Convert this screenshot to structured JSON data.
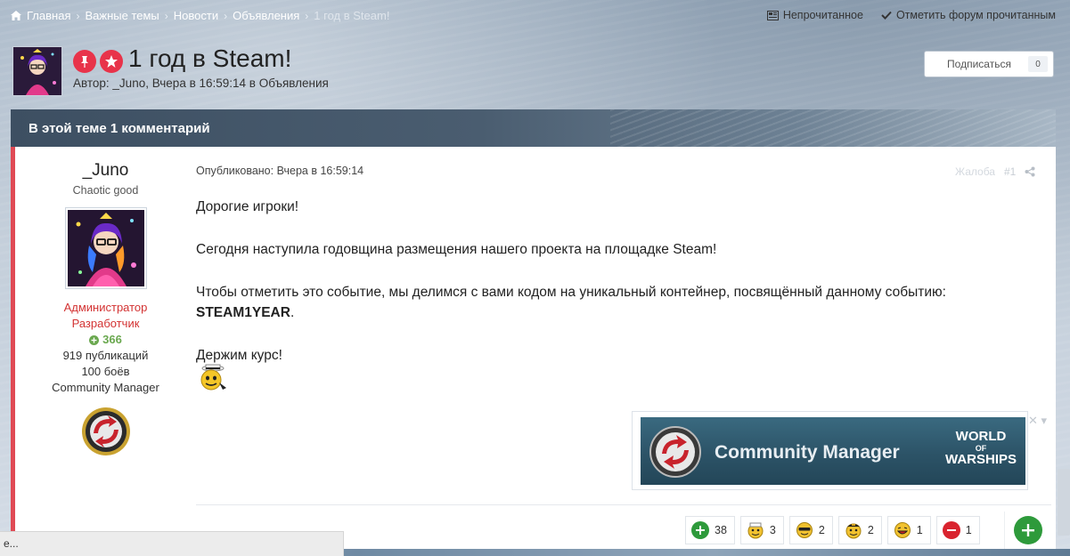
{
  "breadcrumb": {
    "items": [
      "Главная",
      "Важные темы",
      "Новости",
      "Объявления"
    ],
    "current": "1 год в Steam!"
  },
  "top_actions": {
    "unread": "Непрочитанное",
    "mark_read": "Отметить форум прочитанным"
  },
  "topic": {
    "title": "1 год в Steam!",
    "byline": "Автор: _Juno, Вчера в 16:59:14 в Объявления",
    "subscribe_label": "Подписаться",
    "subscribe_count": "0"
  },
  "comments_bar": "В этой теме 1 комментарий",
  "post": {
    "author": {
      "name": "_Juno",
      "title": "Chaotic good",
      "role1": "Администратор",
      "role2": "Разработчик",
      "reputation": "366",
      "posts": "919 публикаций",
      "battles": "100 боёв",
      "group": "Community Manager"
    },
    "meta": "Опубликовано: Вчера в 16:59:14",
    "report": "Жалоба",
    "number": "#1",
    "body": {
      "p1": "Дорогие игроки!",
      "p2": "Сегодня наступила годовщина размещения нашего проекта на площадке Steam!",
      "p3": "Чтобы отметить это событие, мы делимся с вами кодом на уникальный контейнер, посвящённый данному событию:",
      "code": "STEAM1YEAR",
      "code_tail": ".",
      "p4": "Держим курс!"
    },
    "banner": {
      "text": "Community Manager",
      "logo_line1": "WORLD",
      "logo_line2": "OF",
      "logo_line3": "WARSHIPS"
    },
    "reactions": [
      {
        "icon": "plus-reaction-icon",
        "count": "38",
        "color": "#2e9a3b"
      },
      {
        "icon": "sailor-smile-icon",
        "count": "3",
        "color": "#f2c230"
      },
      {
        "icon": "sunglasses-smile-icon",
        "count": "2",
        "color": "#f2c230"
      },
      {
        "icon": "captain-smile-icon",
        "count": "2",
        "color": "#f2c230"
      },
      {
        "icon": "laugh-smile-icon",
        "count": "1",
        "color": "#f2c230"
      },
      {
        "icon": "minus-reaction-icon",
        "count": "1",
        "color": "#d9232e"
      }
    ]
  },
  "status_bar": "e...",
  "colors": {
    "accent_red": "#e8334a",
    "post_border": "#e04a55",
    "positive": "#2e9a3b"
  }
}
